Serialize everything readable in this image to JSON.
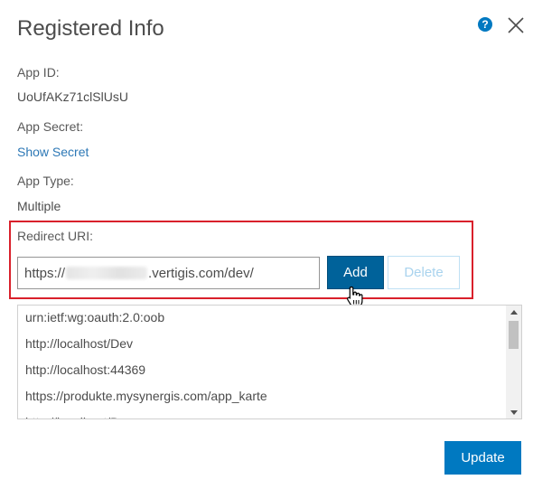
{
  "dialog": {
    "title": "Registered Info",
    "help_glyph": "?",
    "help_icon": "question-circle-icon",
    "close_icon": "close-icon"
  },
  "fields": {
    "app_id_label": "App ID:",
    "app_id_value": "UoUfAKz71clSlUsU",
    "app_secret_label": "App Secret:",
    "show_secret_link": "Show Secret",
    "app_type_label": "App Type:",
    "app_type_value": "Multiple"
  },
  "redirect": {
    "label": "Redirect URI:",
    "input_prefix": "https://",
    "input_suffix": ".vertigis.com/dev/",
    "add_label": "Add",
    "delete_label": "Delete",
    "highlight_color": "#d9202b"
  },
  "uri_list": {
    "items": [
      "urn:ietf:wg:oauth:2.0:oob",
      "http://localhost/Dev",
      "http://localhost:44369",
      "https://produkte.mysynergis.com/app_karte",
      "http://localhost/Dev"
    ]
  },
  "footer": {
    "update_label": "Update"
  },
  "colors": {
    "primary": "#0079c1",
    "primary_dark": "#00629a",
    "link": "#2d78b6"
  }
}
